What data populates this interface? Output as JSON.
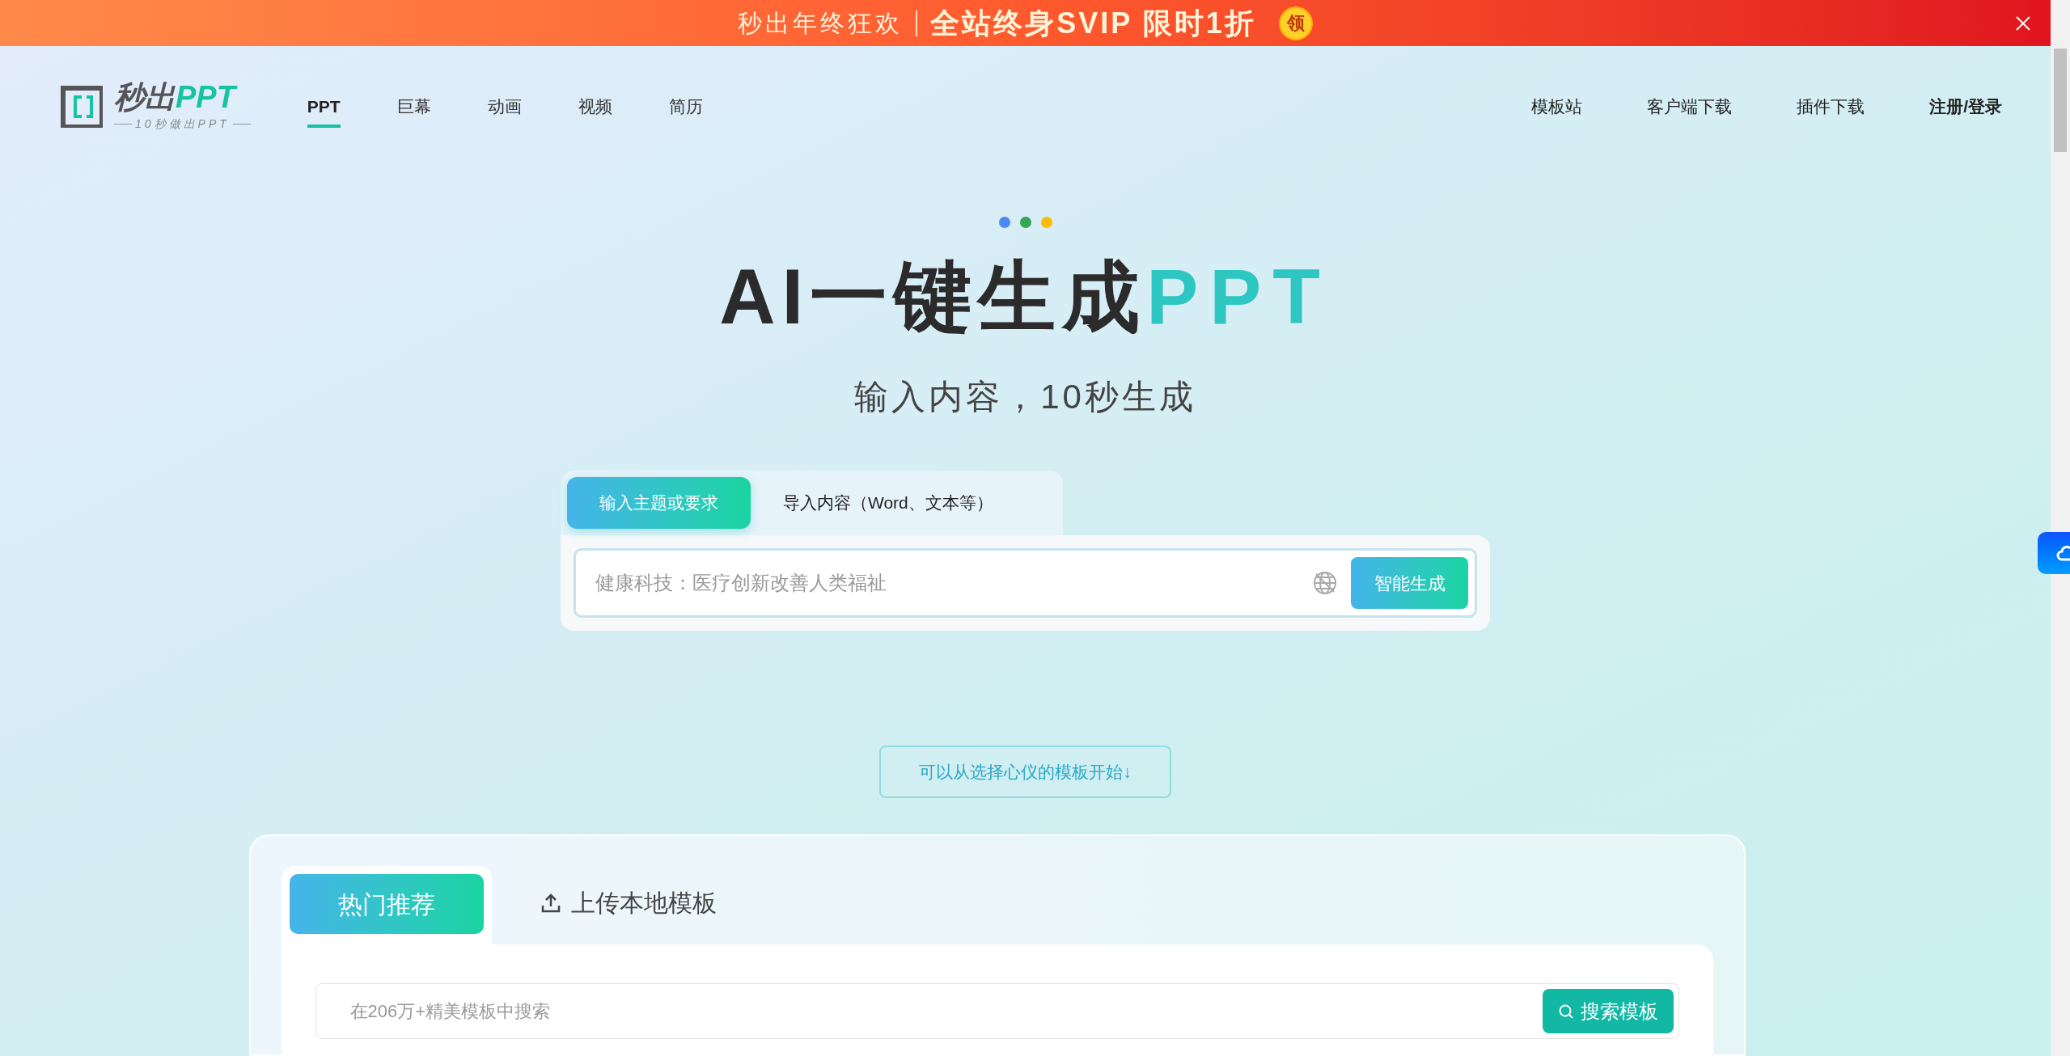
{
  "promo_banner": {
    "lead": "秒出年终狂欢",
    "offer": "全站终身SVIP 限时1折",
    "badge": "领"
  },
  "logo": {
    "wordmark": "秒出",
    "wordmark_accent": "PPT",
    "tagline": "10秒做出PPT"
  },
  "nav": [
    {
      "label": "PPT",
      "selected": true
    },
    {
      "label": "巨幕",
      "selected": false
    },
    {
      "label": "动画",
      "selected": false
    },
    {
      "label": "视频",
      "selected": false
    },
    {
      "label": "简历",
      "selected": false
    }
  ],
  "right_nav": [
    {
      "label": "模板站",
      "kind": "link"
    },
    {
      "label": "客户端下载",
      "kind": "link"
    },
    {
      "label": "插件下载",
      "kind": "link"
    },
    {
      "label": "注册/登录",
      "kind": "account"
    }
  ],
  "hero": {
    "title": "AI一键生成",
    "title_accent": "PPT",
    "subtitle": "输入内容，10秒生成"
  },
  "input_tabs": [
    {
      "label": "输入主题或要求",
      "selected": true
    },
    {
      "label": "导入内容（Word、文本等）",
      "selected": false
    }
  ],
  "prompt": {
    "placeholder": "健康科技：医疗创新改善人类福祉",
    "button": "智能生成"
  },
  "template_hint": "可以从选择心仪的模板开始↓",
  "template_tabs": [
    {
      "label": "热门推荐",
      "selected": true,
      "kind": "plain"
    },
    {
      "label": "上传本地模板",
      "selected": false,
      "kind": "upload"
    }
  ],
  "template_search": {
    "placeholder": "在206万+精美模板中搜索",
    "button": "搜索模板"
  }
}
